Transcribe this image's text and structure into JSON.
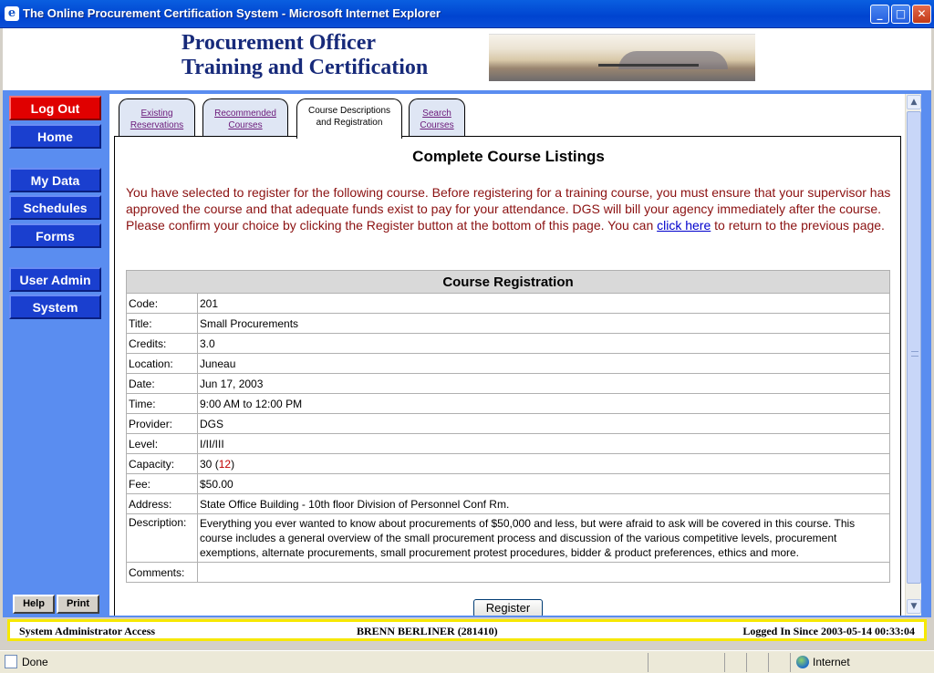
{
  "window": {
    "title": "The Online Procurement Certification System - Microsoft Internet Explorer",
    "minimize_glyph": "_",
    "maximize_glyph": "□",
    "close_glyph": "✕"
  },
  "banner": {
    "line1": "Procurement Officer",
    "line2": "Training and Certification"
  },
  "nav": {
    "logout": "Log Out",
    "home": "Home",
    "my_data": "My Data",
    "schedules": "Schedules",
    "forms": "Forms",
    "user_admin": "User Admin",
    "system": "System",
    "help": "Help",
    "print": "Print"
  },
  "tabs": [
    {
      "line1": "Existing",
      "line2": "Reservations"
    },
    {
      "line1": "Recommended",
      "line2": "Courses"
    },
    {
      "line1": "Course Descriptions",
      "line2": "and Registration"
    },
    {
      "line1": "Search",
      "line2": "Courses"
    }
  ],
  "listing_title": "Complete Course Listings",
  "notice": {
    "text": "You have selected to register for the following course. Before registering for a training course, you must ensure that your supervisor has approved the course and that adequate funds exist to pay for your attendance. DGS will bill your agency immediately after the course. Please confirm your choice by clicking the Register button at the bottom of this page. You can ",
    "link": "click here",
    "after_link": " to return to the previous page."
  },
  "registration": {
    "heading": "Course Registration",
    "fields": {
      "code": {
        "label": "Code:",
        "value": "201"
      },
      "title": {
        "label": "Title:",
        "value": "Small Procurements"
      },
      "credits": {
        "label": "Credits:",
        "value": "3.0"
      },
      "location": {
        "label": "Location:",
        "value": "Juneau"
      },
      "date": {
        "label": "Date:",
        "value": "Jun 17, 2003"
      },
      "time": {
        "label": "Time:",
        "value": "9:00 AM to 12:00 PM"
      },
      "provider": {
        "label": "Provider:",
        "value": "DGS"
      },
      "level": {
        "label": "Level:",
        "value": "I/II/III"
      },
      "capacity": {
        "label": "Capacity:",
        "value": "30",
        "open_paren": "(",
        "remaining": "12",
        "close_paren": ")"
      },
      "fee": {
        "label": "Fee:",
        "value": "$50.00"
      },
      "address": {
        "label": "Address:",
        "value": "State Office Building - 10th floor Division of Personnel Conf Rm."
      },
      "description": {
        "label": "Description:",
        "value": "Everything you ever wanted to know about procurements of $50,000 and less, but were afraid to ask will be covered in this course. This course includes a general overview of the small procurement process and discussion of the various competitive levels, procurement exemptions, alternate procurements, small procurement protest procedures, bidder & product preferences, ethics and more."
      },
      "comments": {
        "label": "Comments:",
        "value": ""
      }
    },
    "register_button": "Register"
  },
  "access_bar": {
    "role": "System Administrator Access",
    "user": "BRENN BERLINER (281410)",
    "logged_in": "Logged In Since 2003-05-14 00:33:04"
  },
  "statusbar": {
    "status": "Done",
    "zone": "Internet"
  },
  "scrollbar": {
    "up": "▲",
    "down": "▼"
  },
  "colors": {
    "nav_blue": "#1a3fcf",
    "logout_red": "#e00000",
    "frame_blue": "#5a8df0",
    "notice_text": "#8b1111",
    "access_bar_border": "#f6e800"
  },
  "icons": {
    "browser": "ie-icon",
    "zone": "globe-icon"
  }
}
